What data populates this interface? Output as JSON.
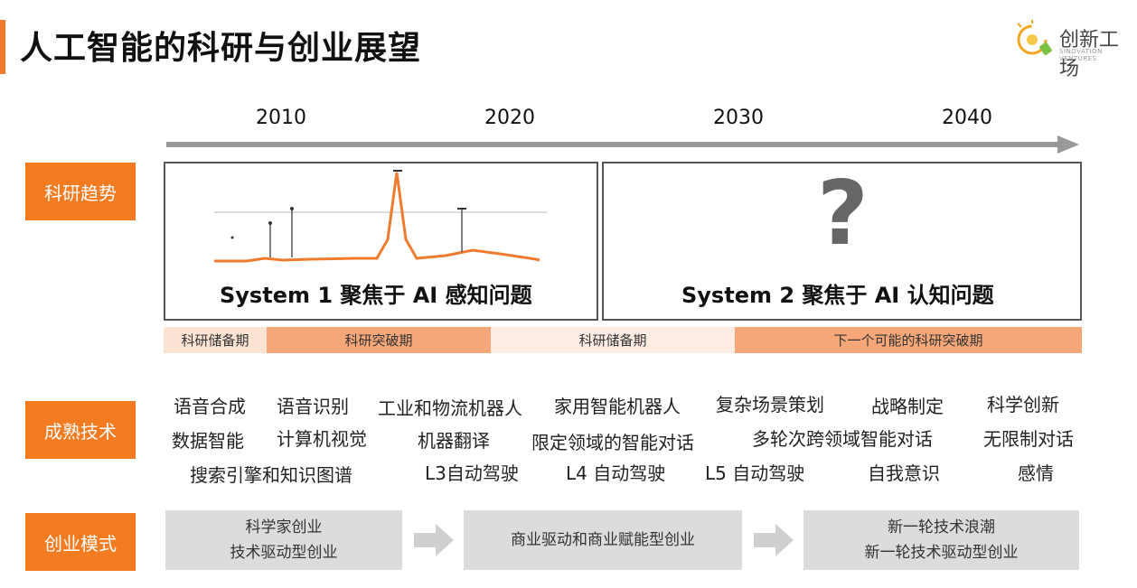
{
  "header": {
    "title": "人工智能的科研与创业展望"
  },
  "logo": {
    "name": "创新工场",
    "subtitle": "SINOVATION VENTURES"
  },
  "timeline": {
    "years": [
      "2010",
      "2020",
      "2030",
      "2040"
    ]
  },
  "rows": {
    "research": "科研趋势",
    "tech": "成熟技术",
    "startup": "创业模式"
  },
  "panels": {
    "system1": "System 1  聚焦于 AI 感知问题",
    "system2": "System 2  聚焦于 AI 认知问题",
    "question_mark": "?"
  },
  "phases": [
    "科研储备期",
    "科研突破期",
    "科研储备期",
    "下一个可能的科研突破期"
  ],
  "tech_items": [
    "语音合成",
    "语音识别",
    "工业和物流机器人",
    "家用智能机器人",
    "复杂场景策划",
    "战略制定",
    "科学创新",
    "数据智能",
    "计算机视觉",
    "机器翻译",
    "限定领域的智能对话",
    "多轮次跨领域智能对话",
    "无限制对话",
    "搜索引擎和知识图谱",
    "L3自动驾驶",
    "L4 自动驾驶",
    "L5 自动驾驶",
    "自我意识",
    "感情"
  ],
  "startup_modes": [
    {
      "line1": "科学家创业",
      "line2": "技术驱动型创业"
    },
    {
      "line1": "商业驱动和商业赋能型创业",
      "line2": ""
    },
    {
      "line1": "新一轮技术浪潮",
      "line2": "新一轮技术驱动型创业"
    }
  ],
  "colors": {
    "accent": "#f47b20",
    "phase_light": "#fde3d3",
    "phase_dark": "#f5a77a",
    "phase_lighter": "#fdece3",
    "mode_box": "#dcdcdc"
  }
}
